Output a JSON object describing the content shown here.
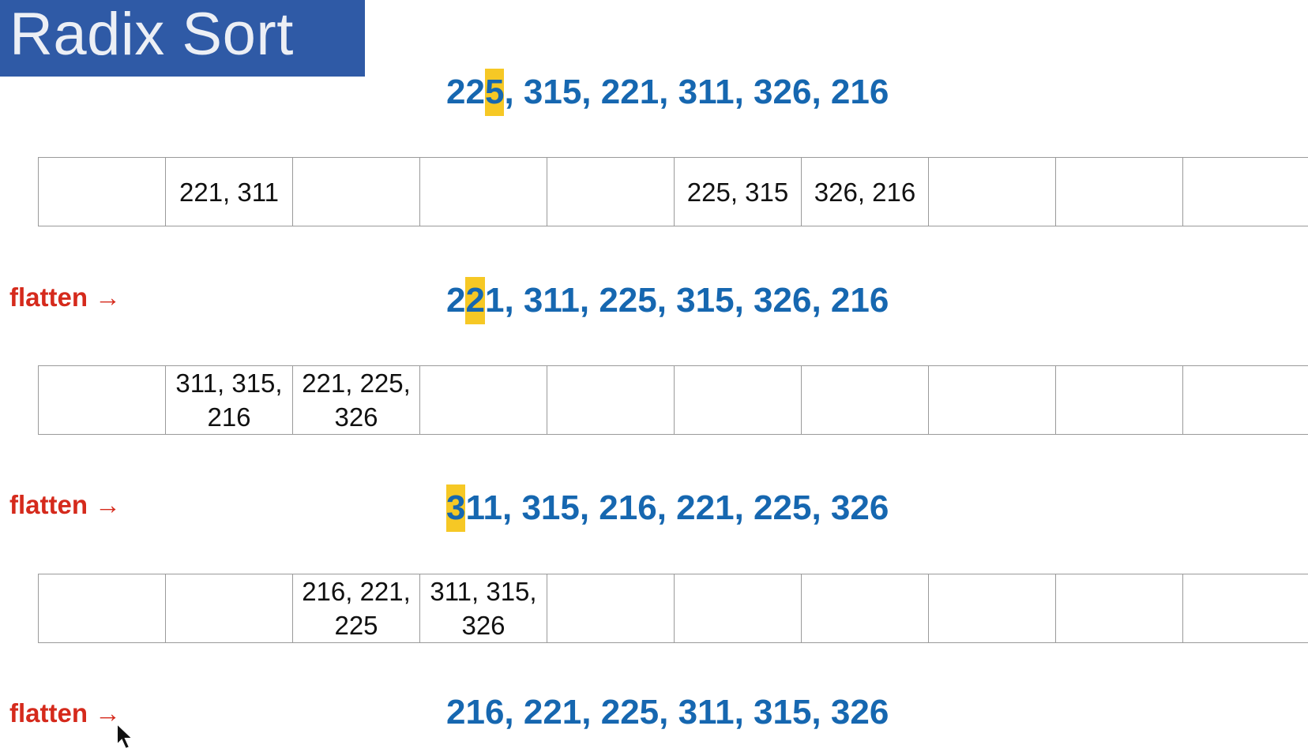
{
  "title": "Radix Sort",
  "flatten_label": "flatten →",
  "sequences": [
    {
      "pre": "22",
      "hl": "5",
      "post": ", 315, 221, 311, 326, 216"
    },
    {
      "pre": "2",
      "hl": "2",
      "post": "1, 311, 225, 315, 326, 216"
    },
    {
      "pre": "",
      "hl": "3",
      "post": "11, 315, 216, 221, 225, 326"
    },
    {
      "pre": "",
      "hl": "",
      "post": "216, 221, 225, 311, 315, 326"
    }
  ],
  "bucket_rows": [
    [
      "",
      "221, 311",
      "",
      "",
      "",
      "225, 315",
      "326, 216",
      "",
      "",
      ""
    ],
    [
      "",
      "311, 315,\n216",
      "221, 225,\n326",
      "",
      "",
      "",
      "",
      "",
      "",
      ""
    ],
    [
      "",
      "",
      "216, 221,\n225",
      "311, 315,\n326",
      "",
      "",
      "",
      "",
      "",
      ""
    ]
  ],
  "colors": {
    "title_bg": "#2f5aa6",
    "number_blue": "#1667b0",
    "highlight": "#f6c825",
    "flatten_red": "#d52a1c"
  }
}
